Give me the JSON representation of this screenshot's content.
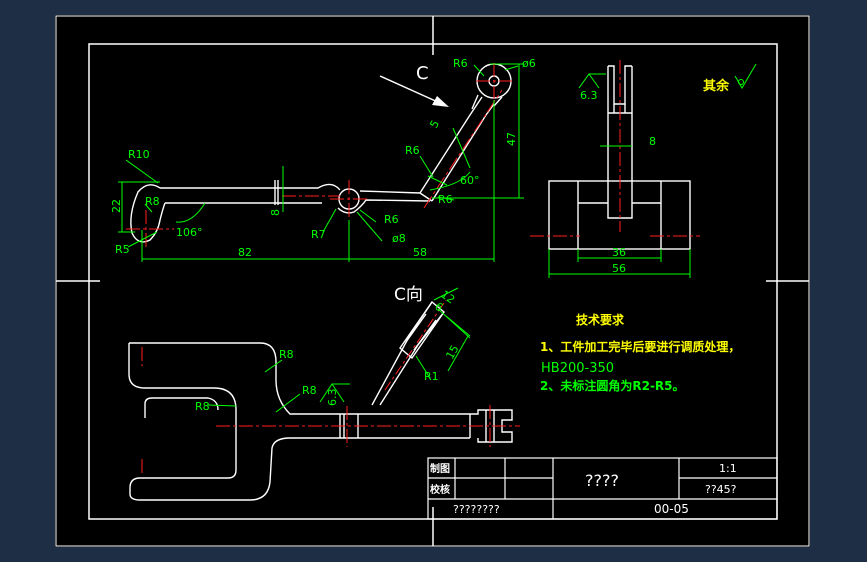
{
  "colors": {
    "background": "#1e2f45",
    "paper": "#000000",
    "part_line": "#ffffff",
    "dimension": "#00ff00",
    "centerline": "#ff2020",
    "text_yellow": "#ffff00",
    "text_white": "#ffffff"
  },
  "dims_front": {
    "r10": "R10",
    "r8": "R8",
    "r5": "R5",
    "d22": "22",
    "a106": "106°",
    "d8v": "8",
    "d82": "82",
    "d58": "58",
    "r7": "R7",
    "r6a": "R6",
    "phi8": "ø8",
    "r6b": "R6",
    "r6c": "R6",
    "r6d": "R6",
    "phi6": "ø6",
    "d5": "5",
    "a60": "60°",
    "d47": "47"
  },
  "view_arrow_label": "C",
  "dims_side": {
    "rough": "6.3",
    "d8": "8",
    "d36": "36",
    "d56": "56"
  },
  "qiyu": "其余",
  "view_c": {
    "title": "C向",
    "d12": "12",
    "d6": "6",
    "d15": "15",
    "r1": "R1"
  },
  "plan_dims": {
    "r8a": "R8",
    "r8b": "R8",
    "r8c": "R8",
    "rough": "6.3"
  },
  "tech": {
    "title": "技术要求",
    "line1": "1、工件加工完毕后要进行调质处理，",
    "line2": "HB200-350",
    "line3": "2、未标注圆角为R2-R5。"
  },
  "title_block": {
    "draw": "制图",
    "check": "校核",
    "name": "????",
    "scale": "1:1",
    "material": "??45?",
    "school": "????????",
    "drawing_no": "00-05"
  }
}
